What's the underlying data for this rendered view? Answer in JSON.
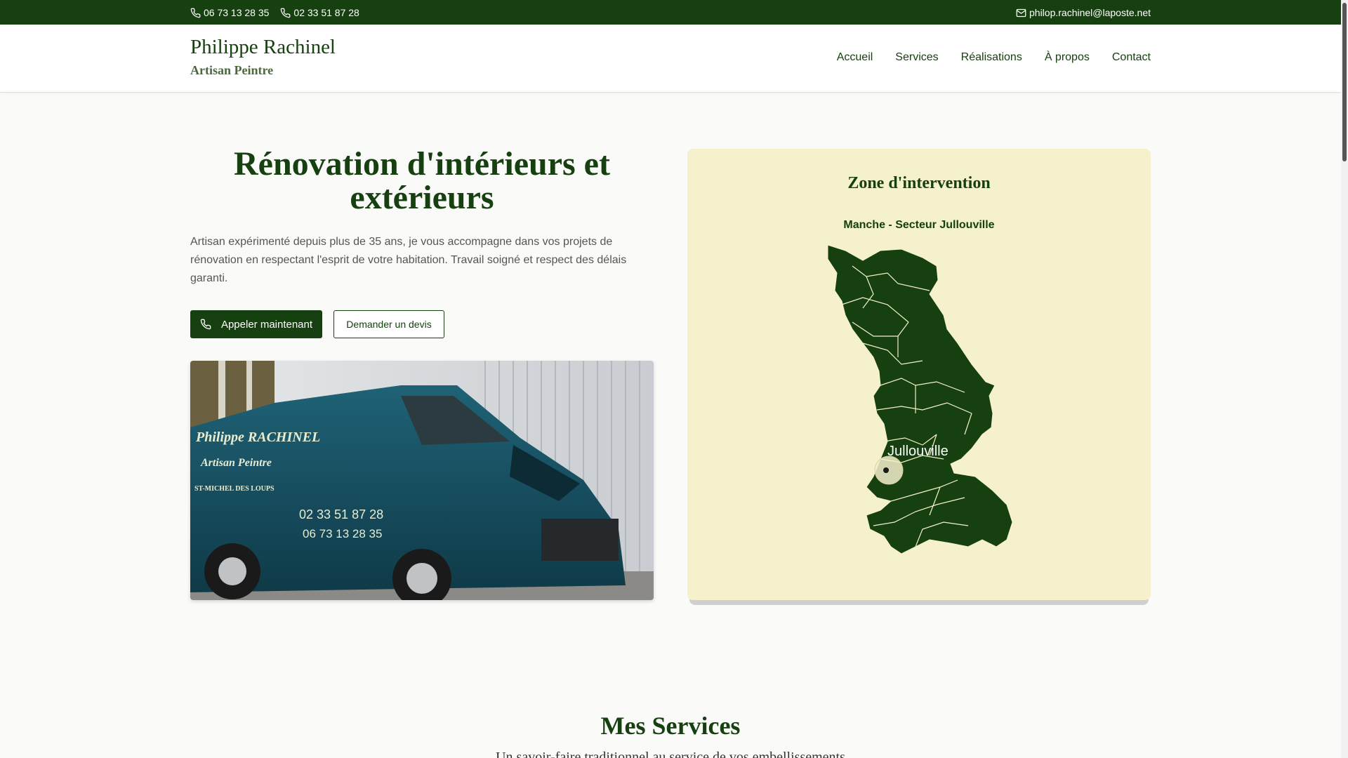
{
  "topbar": {
    "phone1": "06 73 13 28 35",
    "phone2": "02 33 51 87 28",
    "email": "philop.rachinel@laposte.net"
  },
  "header": {
    "brand_name": "Philippe Rachinel",
    "brand_tagline": "Artisan Peintre",
    "nav": [
      "Accueil",
      "Services",
      "Réalisations",
      "À propos",
      "Contact"
    ]
  },
  "hero": {
    "title": "Rénovation d'intérieurs et extérieurs",
    "text": "Artisan expérimenté depuis plus de 35 ans, je vous accompagne dans vos projets de rénovation en respectant l'esprit de votre habitation. Travail soigné et respect des délais garanti.",
    "primary_button": "Appeler maintenant",
    "secondary_button": "Demander un devis",
    "van": {
      "name": "Philippe RACHINEL",
      "tagline": "Artisan Peintre",
      "location": "ST-MICHEL DES LOUPS",
      "phone1": "02 33 51 87 28",
      "phone2": "06 73 13 28 35"
    }
  },
  "zone": {
    "title": "Zone d'intervention",
    "subtitle": "Manche - Secteur Jullouville",
    "marker_label": "Jullouville"
  },
  "services": {
    "title": "Mes Services",
    "subtitle": "Un savoir-faire traditionnel au service de vos embellissements"
  },
  "colors": {
    "brand_green": "#16400f",
    "zone_bg": "#f5f1cd"
  }
}
